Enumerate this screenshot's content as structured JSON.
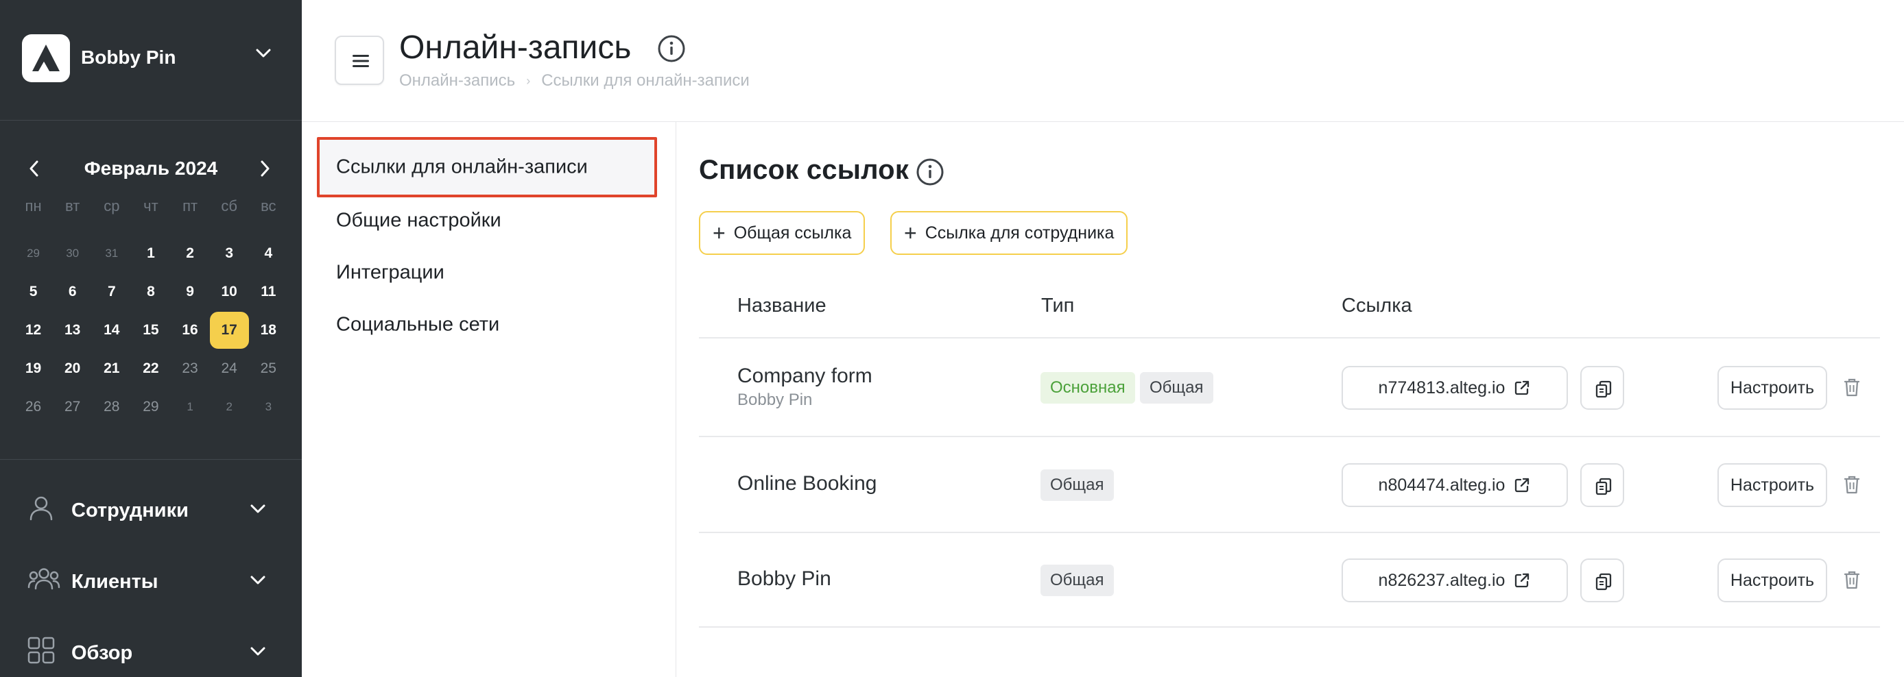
{
  "brand": {
    "name": "Bobby Pin",
    "logo_icon": "alteg-logo-icon",
    "chevron_icon": "chevron-down-icon"
  },
  "calendar": {
    "title": "Февраль 2024",
    "weekdays": [
      "пн",
      "вт",
      "ср",
      "чт",
      "пт",
      "сб",
      "вс"
    ],
    "weeks": [
      [
        "29",
        "30",
        "31",
        "1",
        "2",
        "3",
        "4"
      ],
      [
        "5",
        "6",
        "7",
        "8",
        "9",
        "10",
        "11"
      ],
      [
        "12",
        "13",
        "14",
        "15",
        "16",
        "17",
        "18"
      ],
      [
        "19",
        "20",
        "21",
        "22",
        "23",
        "24",
        "25"
      ],
      [
        "26",
        "27",
        "28",
        "29",
        "1",
        "2",
        "3"
      ]
    ],
    "selected_day": "17",
    "selected_color": "#f5cf4c"
  },
  "nav": {
    "items": [
      {
        "label": "Сотрудники",
        "icon": "user-icon"
      },
      {
        "label": "Клиенты",
        "icon": "users-icon"
      },
      {
        "label": "Обзор",
        "icon": "grid-icon"
      }
    ]
  },
  "header": {
    "title": "Онлайн-запись",
    "breadcrumb": [
      "Онлайн-запись",
      "Ссылки для онлайн-записи"
    ],
    "breadcrumb_separator": "›"
  },
  "settings_menu": {
    "items": [
      "Ссылки для онлайн-записи",
      "Общие настройки",
      "Интеграции",
      "Социальные сети"
    ],
    "active_index": 0,
    "highlight_color": "#e0442b"
  },
  "content": {
    "title": "Список ссылок",
    "add_buttons": {
      "common": "Общая ссылка",
      "employee": "Ссылка для сотрудника"
    },
    "columns": {
      "name": "Название",
      "type": "Тип",
      "link": "Ссылка"
    },
    "config_label": "Настроить",
    "rows": [
      {
        "name": "Company form",
        "subtitle": "Bobby Pin",
        "badges": [
          "Основная",
          "Общая"
        ],
        "link": "n774813.alteg.io"
      },
      {
        "name": "Online Booking",
        "subtitle": "",
        "badges": [
          "Общая"
        ],
        "link": "n804474.alteg.io"
      },
      {
        "name": "Bobby Pin",
        "subtitle": "",
        "badges": [
          "Общая"
        ],
        "link": "n826237.alteg.io"
      }
    ]
  },
  "colors": {
    "sidebar_bg": "#2c3135",
    "accent_yellow": "#f5cf4c",
    "badge_main_text": "#4ba13a"
  }
}
